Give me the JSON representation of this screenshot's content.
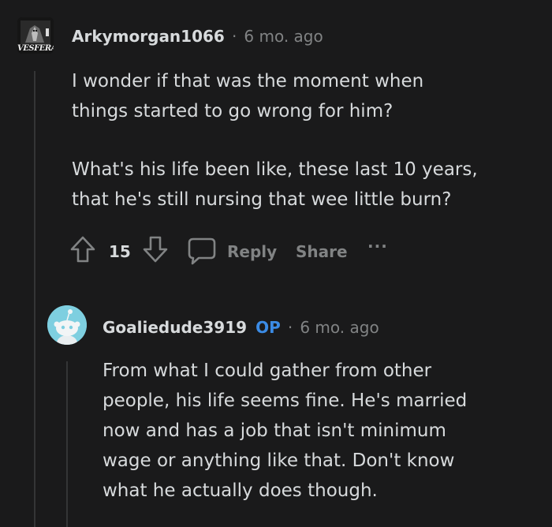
{
  "comment1": {
    "avatar_label": "VESFERATU",
    "username": "Arkymorgan1066",
    "separator": "·",
    "age": "6 mo. ago",
    "paragraphs": [
      [
        "I wonder if that was the moment when",
        "things started to go wrong for him?"
      ],
      [
        "What's his life been like, these last 10 years,",
        "that he's still nursing that wee little burn?"
      ]
    ],
    "votes": "15",
    "reply_label": "Reply",
    "share_label": "Share",
    "more_label": "···"
  },
  "comment2": {
    "username": "Goaliedude3919",
    "op_badge": "OP",
    "separator": "·",
    "age": "6 mo. ago",
    "lines": [
      "From what I could gather from other",
      "people, his life seems fine. He's married",
      "now and has a job that isn't minimum",
      "wage or anything like that. Don't know",
      "what he actually does though."
    ]
  },
  "colors": {
    "background": "#1a1a1b",
    "text": "#d7dadc",
    "muted": "#818384",
    "op_blue": "#3b8be5",
    "avatar2_bg": "#7ecfe0"
  }
}
